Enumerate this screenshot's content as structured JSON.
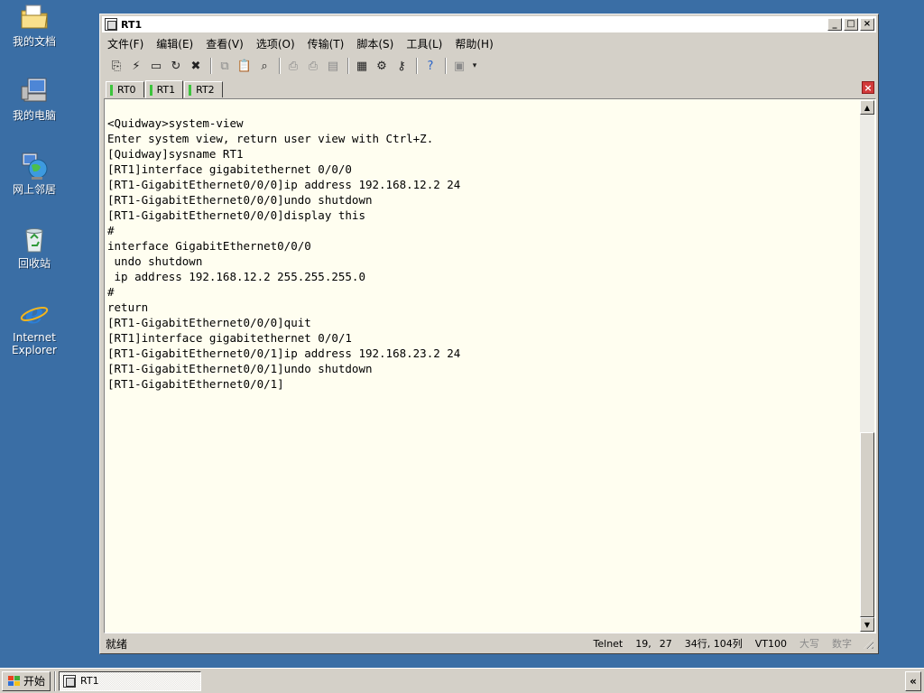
{
  "desktop": {
    "icons": [
      {
        "label": "我的文档"
      },
      {
        "label": "我的电脑"
      },
      {
        "label": "网上邻居"
      },
      {
        "label": "回收站"
      },
      {
        "label": "Internet\nExplorer"
      }
    ]
  },
  "window": {
    "title": "RT1",
    "controls": {
      "minimize": "_",
      "maximize": "□",
      "close": "×"
    },
    "menu": [
      {
        "label": "文件(F)"
      },
      {
        "label": "编辑(E)"
      },
      {
        "label": "查看(V)"
      },
      {
        "label": "选项(O)"
      },
      {
        "label": "传输(T)"
      },
      {
        "label": "脚本(S)"
      },
      {
        "label": "工具(L)"
      },
      {
        "label": "帮助(H)"
      }
    ],
    "tabs": [
      {
        "label": "RT0"
      },
      {
        "label": "RT1"
      },
      {
        "label": "RT2"
      }
    ],
    "active_tab": "RT1",
    "tab_close": "×"
  },
  "terminal": {
    "lines": [
      "<Quidway>system-view",
      "Enter system view, return user view with Ctrl+Z.",
      "[Quidway]sysname RT1",
      "[RT1]interface gigabitethernet 0/0/0",
      "[RT1-GigabitEthernet0/0/0]ip address 192.168.12.2 24",
      "[RT1-GigabitEthernet0/0/0]undo shutdown",
      "[RT1-GigabitEthernet0/0/0]display this",
      "#",
      "interface GigabitEthernet0/0/0",
      " undo shutdown",
      " ip address 192.168.12.2 255.255.255.0",
      "#",
      "return",
      "[RT1-GigabitEthernet0/0/0]quit",
      "[RT1]interface gigabitethernet 0/0/1",
      "[RT1-GigabitEthernet0/0/1]ip address 192.168.23.2 24",
      "[RT1-GigabitEthernet0/0/1]undo shutdown",
      "[RT1-GigabitEthernet0/0/1]"
    ]
  },
  "status": {
    "ready": "就绪",
    "protocol": "Telnet",
    "cursor_row": "19,",
    "cursor_col": "27",
    "size": "34行, 104列",
    "emulation": "VT100",
    "caps": "大写",
    "num": "数字"
  },
  "taskbar": {
    "start_label": "开始",
    "task_label": "RT1",
    "tray_arrow": "«"
  },
  "colors": {
    "desktop": "#3a6ea5",
    "terminal_bg": "#fffef0",
    "tab_marker": "#3cc43c",
    "tab_close": "#d23a3a"
  }
}
